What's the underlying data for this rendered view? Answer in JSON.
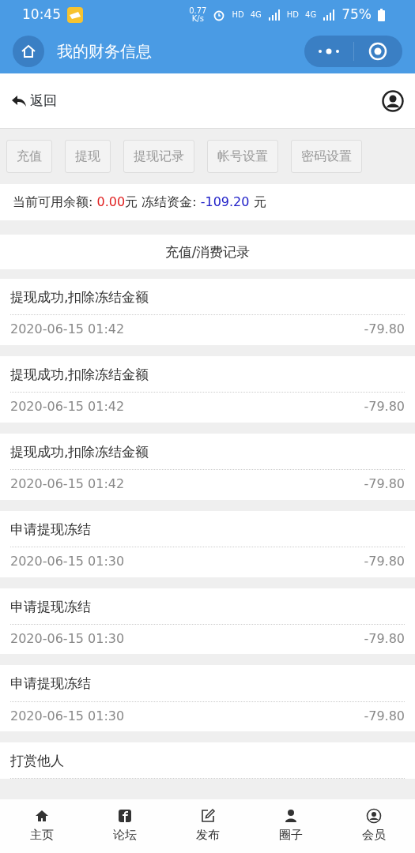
{
  "status_bar": {
    "time": "10:45",
    "speed": "0.77\nK/s",
    "hd1": "HD",
    "net1": "4G",
    "hd2": "HD",
    "net2": "4G",
    "battery": "75%"
  },
  "header": {
    "title": "我的财务信息"
  },
  "topbar": {
    "back": "返回"
  },
  "actions": [
    "充值",
    "提现",
    "提现记录",
    "帐号设置",
    "密码设置"
  ],
  "balance": {
    "available_label": "当前可用余额: ",
    "available": "0.00",
    "available_unit": "元 ",
    "frozen_label": "冻结资金: ",
    "frozen": "-109.20",
    "frozen_unit": " 元"
  },
  "records_title": "充值/消费记录",
  "records": [
    {
      "title": "提现成功,扣除冻结金额",
      "time": "2020-06-15 01:42",
      "amount": "-79.80"
    },
    {
      "title": "提现成功,扣除冻结金额",
      "time": "2020-06-15 01:42",
      "amount": "-79.80"
    },
    {
      "title": "提现成功,扣除冻结金额",
      "time": "2020-06-15 01:42",
      "amount": "-79.80"
    },
    {
      "title": "申请提现冻结",
      "time": "2020-06-15 01:30",
      "amount": "-79.80"
    },
    {
      "title": "申请提现冻结",
      "time": "2020-06-15 01:30",
      "amount": "-79.80"
    },
    {
      "title": "申请提现冻结",
      "time": "2020-06-15 01:30",
      "amount": "-79.80"
    },
    {
      "title": "打赏他人"
    }
  ],
  "tabbar": [
    {
      "kind": "home",
      "label": "主页"
    },
    {
      "kind": "forum",
      "label": "论坛"
    },
    {
      "kind": "post",
      "label": "发布"
    },
    {
      "kind": "circle",
      "label": "圈子"
    },
    {
      "kind": "member",
      "label": "会员"
    }
  ]
}
